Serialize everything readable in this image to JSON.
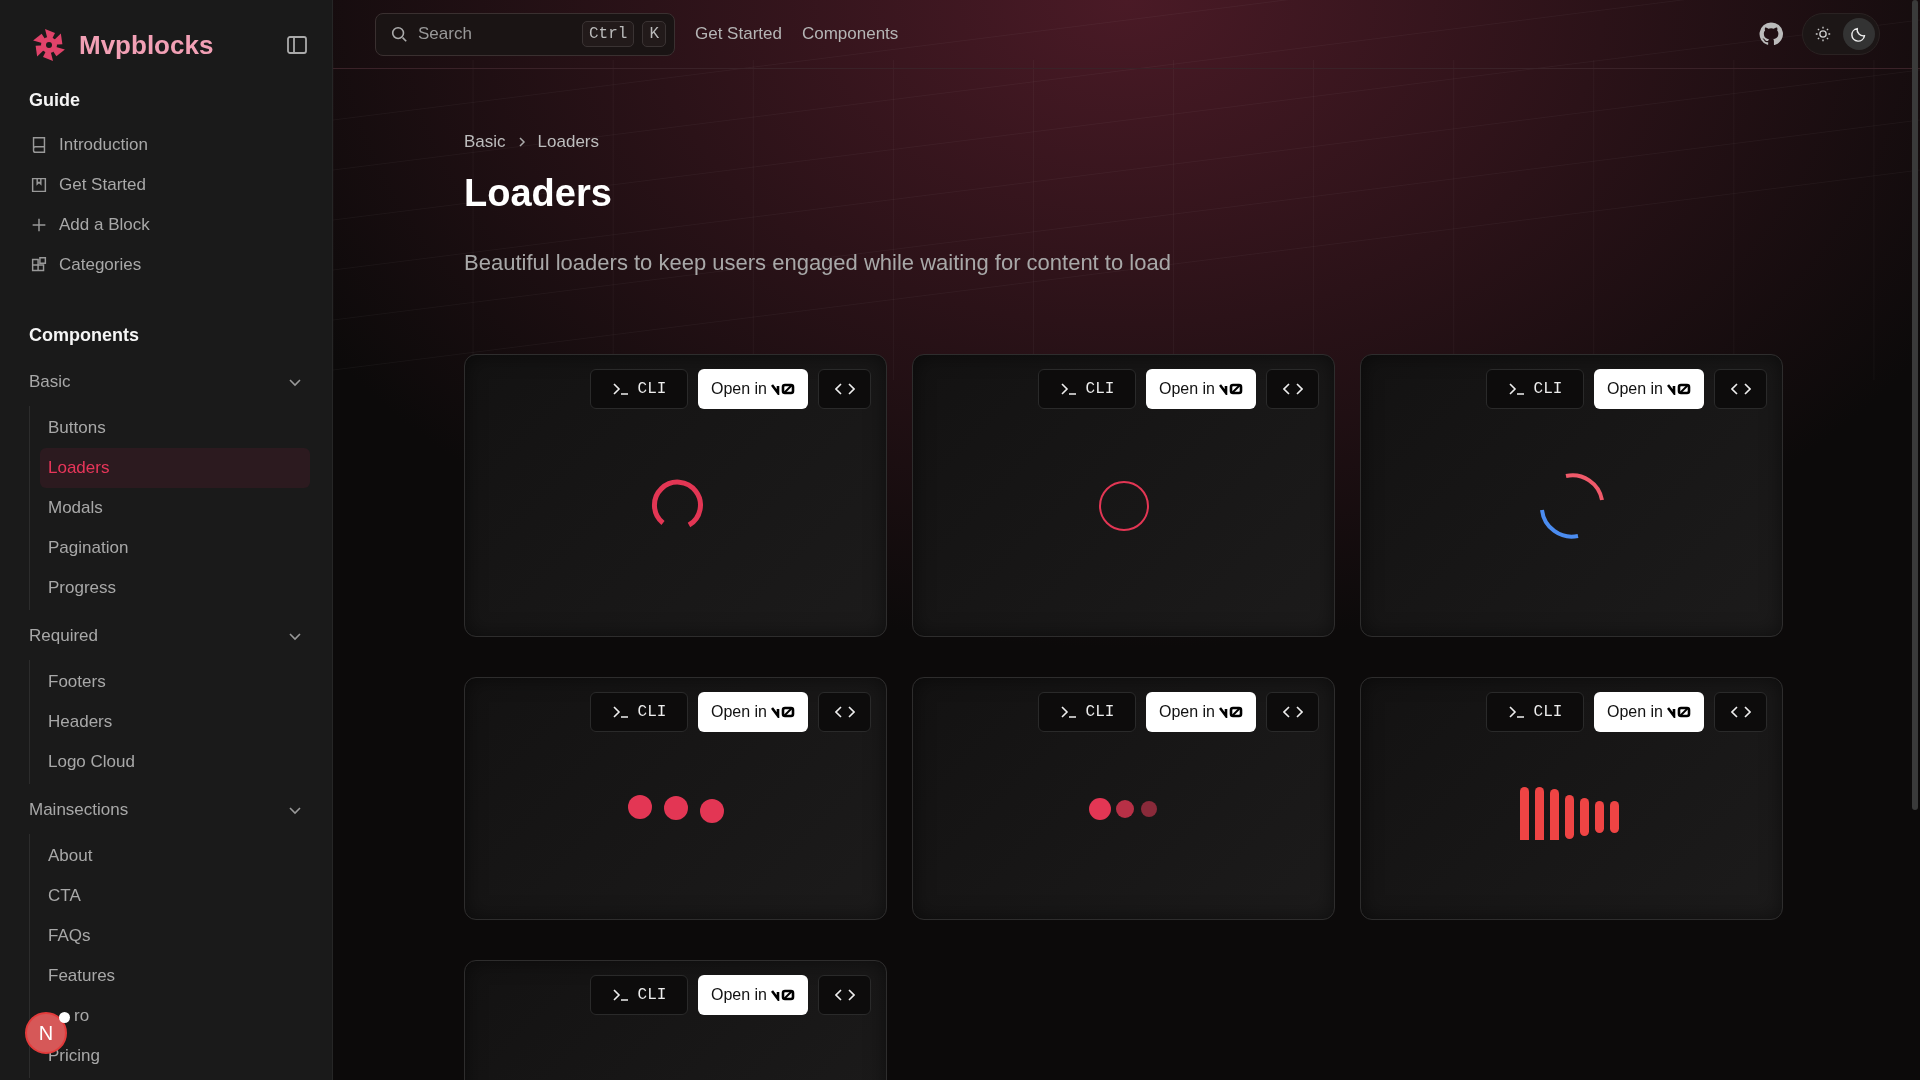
{
  "brand": {
    "name": "Mvpblocks"
  },
  "sidebar": {
    "sections": [
      {
        "title": "Guide",
        "items": [
          {
            "label": "Introduction"
          },
          {
            "label": "Get Started"
          },
          {
            "label": "Add a Block"
          },
          {
            "label": "Categories"
          }
        ]
      },
      {
        "title": "Components",
        "groups": [
          {
            "label": "Basic",
            "expanded": true,
            "children": [
              {
                "label": "Buttons",
                "selected": false
              },
              {
                "label": "Loaders",
                "selected": true
              },
              {
                "label": "Modals",
                "selected": false
              },
              {
                "label": "Pagination",
                "selected": false
              },
              {
                "label": "Progress",
                "selected": false
              }
            ]
          },
          {
            "label": "Required",
            "expanded": true,
            "children": [
              {
                "label": "Footers",
                "selected": false
              },
              {
                "label": "Headers",
                "selected": false
              },
              {
                "label": "Logo Cloud",
                "selected": false
              }
            ]
          },
          {
            "label": "Mainsections",
            "expanded": true,
            "children": [
              {
                "label": "About",
                "selected": false
              },
              {
                "label": "CTA",
                "selected": false
              },
              {
                "label": "FAQs",
                "selected": false
              },
              {
                "label": "Features",
                "selected": false
              },
              {
                "label": "ro",
                "selected": false,
                "partly_hidden": true
              },
              {
                "label": "Pricing",
                "selected": false
              }
            ]
          }
        ]
      }
    ]
  },
  "header": {
    "search": {
      "placeholder": "Search",
      "keys": [
        "Ctrl",
        "K"
      ]
    },
    "links": [
      "Get Started",
      "Components"
    ],
    "dark_mode": true
  },
  "breadcrumb": [
    {
      "label": "Basic"
    },
    {
      "label": "Loaders"
    }
  ],
  "page": {
    "title": "Loaders",
    "description": "Beautiful loaders to keep users engaged while waiting for content to load"
  },
  "cards": [
    {
      "kind": "spinner",
      "cli": "CLI",
      "open": "Open in"
    },
    {
      "kind": "ring",
      "cli": "CLI",
      "open": "Open in"
    },
    {
      "kind": "dual-arc",
      "cli": "CLI",
      "open": "Open in"
    },
    {
      "kind": "dots",
      "cli": "CLI",
      "open": "Open in"
    },
    {
      "kind": "pulse-dots",
      "cli": "CLI",
      "open": "Open in"
    },
    {
      "kind": "bars",
      "cli": "CLI",
      "open": "Open in"
    },
    {
      "kind": "none",
      "cli": "CLI",
      "open": "Open in"
    }
  ],
  "badge": {
    "letter": "N"
  }
}
